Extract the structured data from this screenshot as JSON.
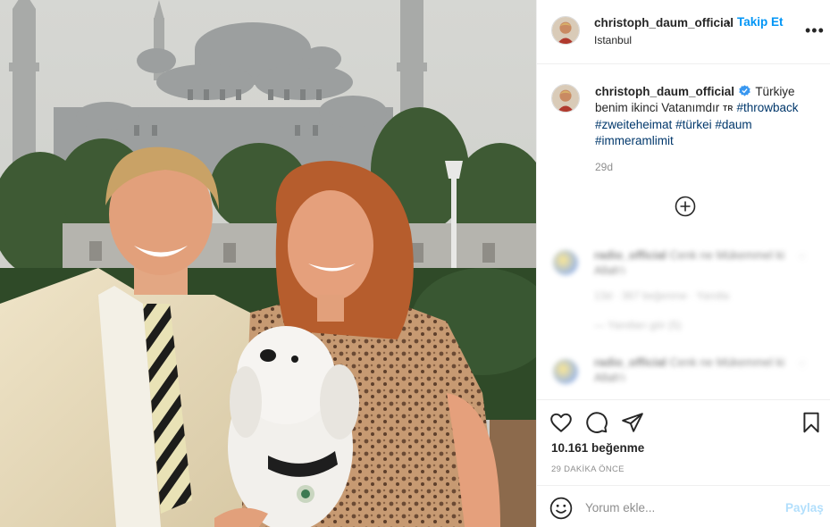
{
  "post": {
    "username": "christoph_daum_official",
    "header_separator": "•",
    "follow_label": "Takip Et",
    "location": "Istanbul",
    "more_label": "•••"
  },
  "caption": {
    "username": "christoph_daum_official",
    "text": "Türkiye benim ikinci Vatanımdır",
    "flag": "TR",
    "hashtags": [
      "#throwback",
      "#zweiteheimat",
      "#türkei",
      "#daum",
      "#immeramlimit"
    ],
    "time": "29d"
  },
  "comments": [
    {
      "username": "radio_official",
      "text": "Cenk ne Mükemmel ki",
      "text2": "Allah'ı",
      "meta": "13d · 367 beğenme · Yanıtla",
      "replies": "— Yanıtları gör (5)"
    },
    {
      "username": "radio_official",
      "text": "Cenk ne Mükemmel ki",
      "text2": "Allah'ı"
    }
  ],
  "actions": {
    "likes": "10.161 beğenme",
    "posted_ago": "29 DAKİKA ÖNCE"
  },
  "comment_box": {
    "placeholder": "Yorum ekle...",
    "share_label": "Paylaş"
  },
  "icons": {
    "like": "heart-icon",
    "comment": "comment-icon",
    "share": "send-icon",
    "save": "bookmark-icon",
    "load_more": "plus-circle-icon",
    "emoji": "emoji-icon",
    "verified": "verified-badge-icon"
  },
  "colors": {
    "accent": "#0095f6",
    "hashtag": "#00376b",
    "muted": "#8e8e8e",
    "share_disabled": "#b2dffc"
  }
}
